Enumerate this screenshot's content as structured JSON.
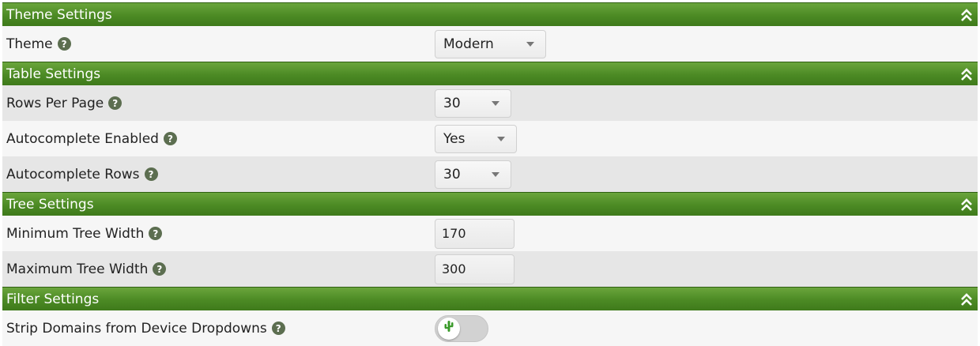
{
  "sections": [
    {
      "title": "Theme Settings"
    },
    {
      "title": "Table Settings"
    },
    {
      "title": "Tree Settings"
    },
    {
      "title": "Filter Settings"
    }
  ],
  "theme": {
    "label": "Theme",
    "value": "Modern"
  },
  "table": {
    "rows_per_page": {
      "label": "Rows Per Page",
      "value": "30"
    },
    "autocomplete_enabled": {
      "label": "Autocomplete Enabled",
      "value": "Yes"
    },
    "autocomplete_rows": {
      "label": "Autocomplete Rows",
      "value": "30"
    }
  },
  "tree": {
    "min_width": {
      "label": "Minimum Tree Width",
      "value": "170"
    },
    "max_width": {
      "label": "Maximum Tree Width",
      "value": "300"
    }
  },
  "filter": {
    "strip_domains": {
      "label": "Strip Domains from Device Dropdowns",
      "enabled": false
    }
  },
  "icons": {
    "help": "question-circle-icon",
    "collapse": "double-chevron-up-icon",
    "toggle_knob": "cactus-icon"
  },
  "colors": {
    "header_green": "#4c8a24",
    "help_icon": "#5c6e50",
    "row_alt": "#e6e6e6",
    "row_plain": "#f6f6f6"
  }
}
